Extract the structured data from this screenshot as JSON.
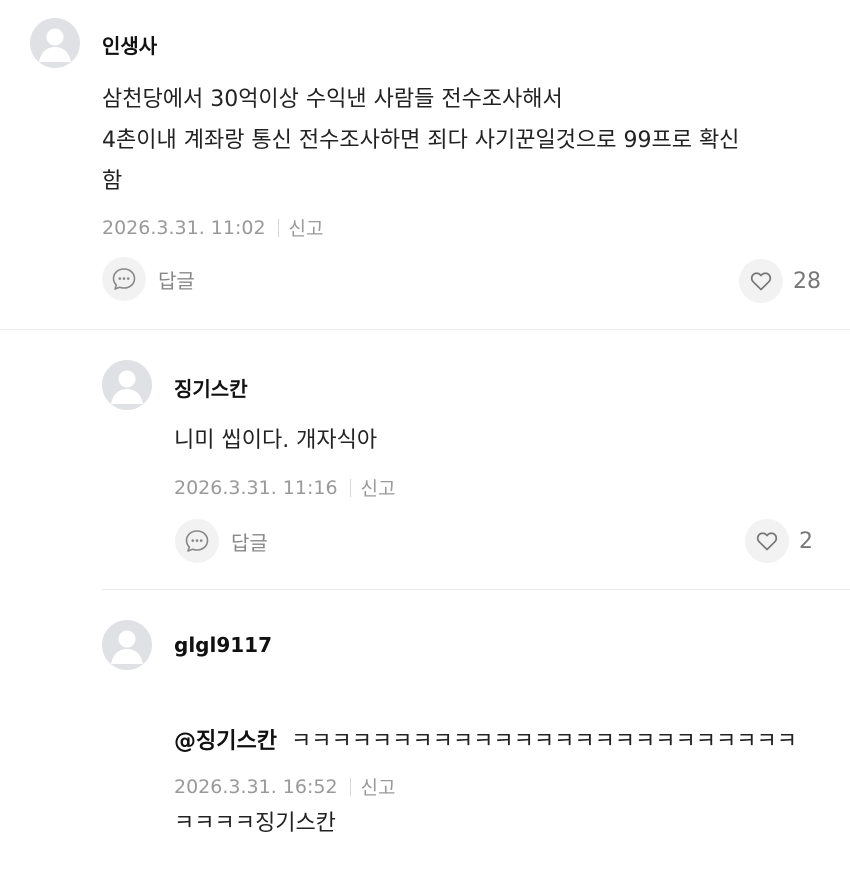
{
  "comments": [
    {
      "author": "인생사",
      "text": "삼천당에서 30억이상 수익낸 사람들 전수조사해서\n4촌이내 계좌랑 통신 전수조사하면 죄다 사기꾼일것으로 99프로 확신\n함",
      "timestamp": "2026.3.31. 11:02",
      "report_label": "신고",
      "reply_label": "답글",
      "like_count": "28"
    },
    {
      "author": "징기스칸",
      "text": "니미 씹이다. 개자식아",
      "timestamp": "2026.3.31. 11:16",
      "report_label": "신고",
      "reply_label": "답글",
      "like_count": "2"
    },
    {
      "author": "glgl9117",
      "mention": "@징기스칸",
      "text_line1": "ㅋㅋㅋㅋㅋㅋㅋㅋㅋㅋㅋㅋㅋㅋㅋㅋㅋㅋㅋㅋㅋㅋㅋㅋㅋ",
      "text_line2": "ㅋㅋㅋㅋ징기스칸",
      "timestamp": "2026.3.31. 16:52",
      "report_label": "신고"
    }
  ],
  "icons": {
    "avatar": "default-user-avatar-icon",
    "reply": "speech-bubble-icon",
    "like": "heart-outline-icon"
  },
  "colors": {
    "avatar_bg": "#dfe1e4",
    "avatar_fg": "#ffffff",
    "meta_text": "#999999",
    "button_bg": "#f2f2f2",
    "divider": "#ebebeb"
  }
}
